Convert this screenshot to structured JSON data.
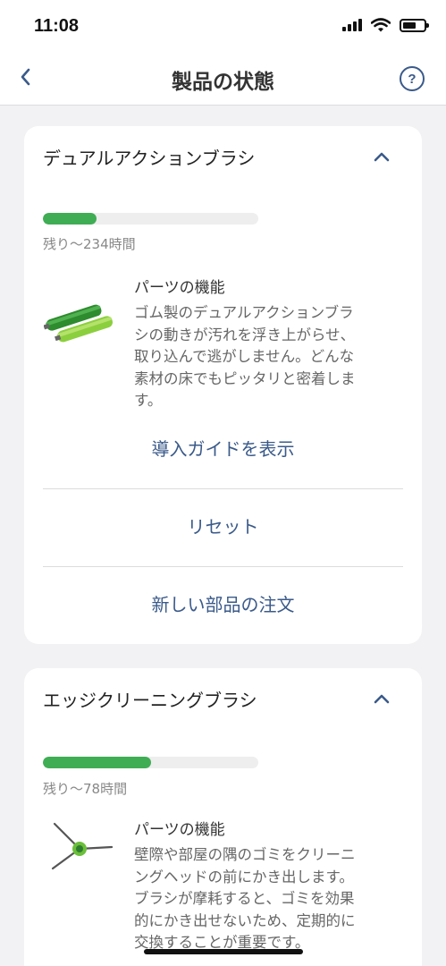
{
  "status_bar": {
    "time": "11:08"
  },
  "nav": {
    "title": "製品の状態"
  },
  "cards": [
    {
      "title": "デュアルアクションブラシ",
      "progress": 0.25,
      "remaining": "残り〜234時間",
      "feature_title": "パーツの機能",
      "feature_lines": [
        "ゴム製のデュアルアクションブラ",
        "シの動きが汚れを浮き上がらせ、",
        "取り込んで逃がしません。どんな",
        "素材の床でもピッタリと密着しま",
        "す。"
      ],
      "actions": {
        "guide": "導入ガイドを表示",
        "reset": "リセット",
        "order": "新しい部品の注文"
      }
    },
    {
      "title": "エッジクリーニングブラシ",
      "progress": 0.5,
      "remaining": "残り〜78時間",
      "feature_title": "パーツの機能",
      "feature_lines": [
        "壁際や部屋の隅のゴミをクリーニ",
        "ングヘッドの前にかき出します。",
        "ブラシが摩耗すると、ゴミを効果",
        "的にかき出せないため、定期的に",
        "交換することが重要です。"
      ]
    }
  ],
  "colors": {
    "progress": "#3fad54",
    "link": "#3a5a8a",
    "background": "#f2f2f4"
  },
  "icons": {
    "back": "chevron-left-icon",
    "help": "help-icon",
    "collapse": "chevron-up-icon"
  }
}
